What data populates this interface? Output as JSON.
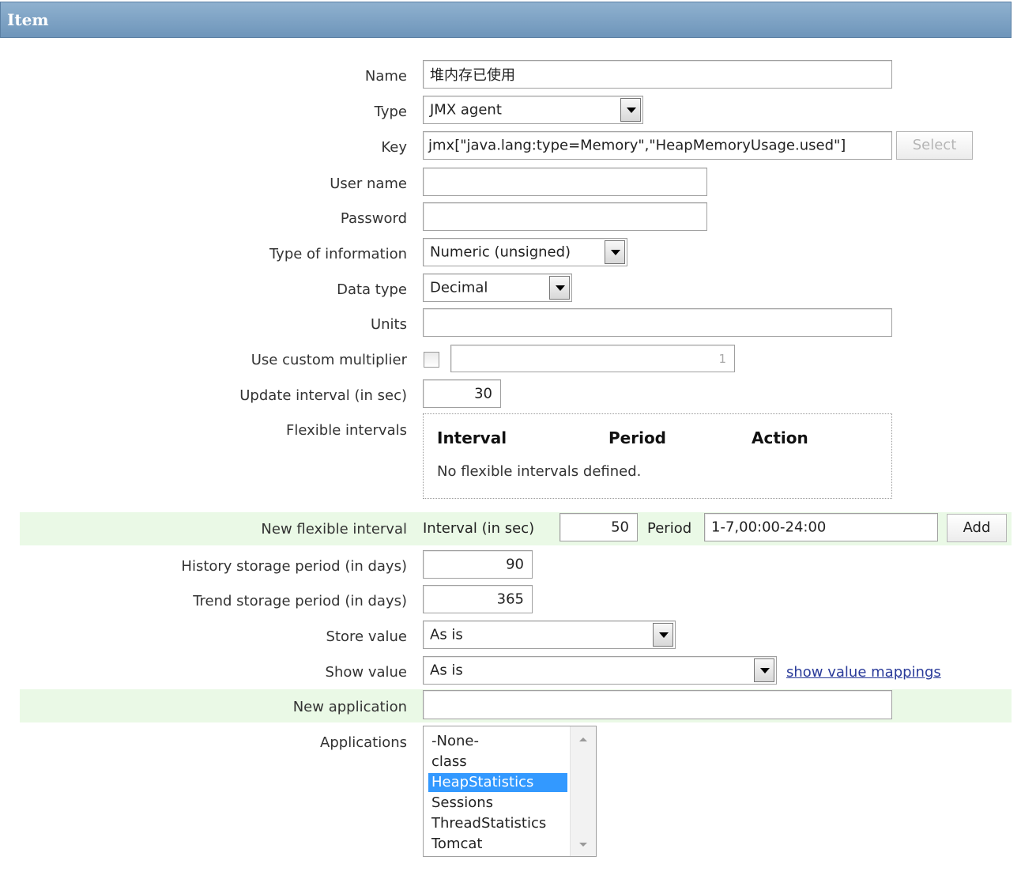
{
  "header": {
    "title": "Item"
  },
  "form": {
    "name": {
      "label": "Name",
      "value": "堆内存已使用"
    },
    "type": {
      "label": "Type",
      "value": "JMX agent"
    },
    "key": {
      "label": "Key",
      "value": "jmx[\"java.lang:type=Memory\",\"HeapMemoryUsage.used\"]",
      "select_button": "Select"
    },
    "user_name": {
      "label": "User name",
      "value": ""
    },
    "password": {
      "label": "Password",
      "value": ""
    },
    "type_of_information": {
      "label": "Type of information",
      "value": "Numeric (unsigned)"
    },
    "data_type": {
      "label": "Data type",
      "value": "Decimal"
    },
    "units": {
      "label": "Units",
      "value": ""
    },
    "custom_multiplier": {
      "label": "Use custom multiplier",
      "checked": false,
      "value": "1"
    },
    "update_interval": {
      "label": "Update interval (in sec)",
      "value": "30"
    },
    "flexible_intervals": {
      "label": "Flexible intervals",
      "columns": [
        "Interval",
        "Period",
        "Action"
      ],
      "empty_text": "No flexible intervals defined."
    },
    "new_flexible_interval": {
      "label": "New flexible interval",
      "interval_label": "Interval (in sec)",
      "interval_value": "50",
      "period_label": "Period",
      "period_value": "1-7,00:00-24:00",
      "add_button": "Add"
    },
    "history_storage": {
      "label": "History storage period (in days)",
      "value": "90"
    },
    "trend_storage": {
      "label": "Trend storage period (in days)",
      "value": "365"
    },
    "store_value": {
      "label": "Store value",
      "value": "As is"
    },
    "show_value": {
      "label": "Show value",
      "value": "As is",
      "link": "show value mappings"
    },
    "new_application": {
      "label": "New application",
      "value": ""
    },
    "applications": {
      "label": "Applications",
      "options": [
        "-None-",
        "class",
        "HeapStatistics",
        "Sessions",
        "ThreadStatistics",
        "Tomcat"
      ],
      "selected": "HeapStatistics"
    }
  },
  "colors": {
    "header": "#7ea3c6",
    "highlight_row": "#eaf9e6",
    "selected_option": "#3399ff",
    "link": "#2a3b9a"
  }
}
